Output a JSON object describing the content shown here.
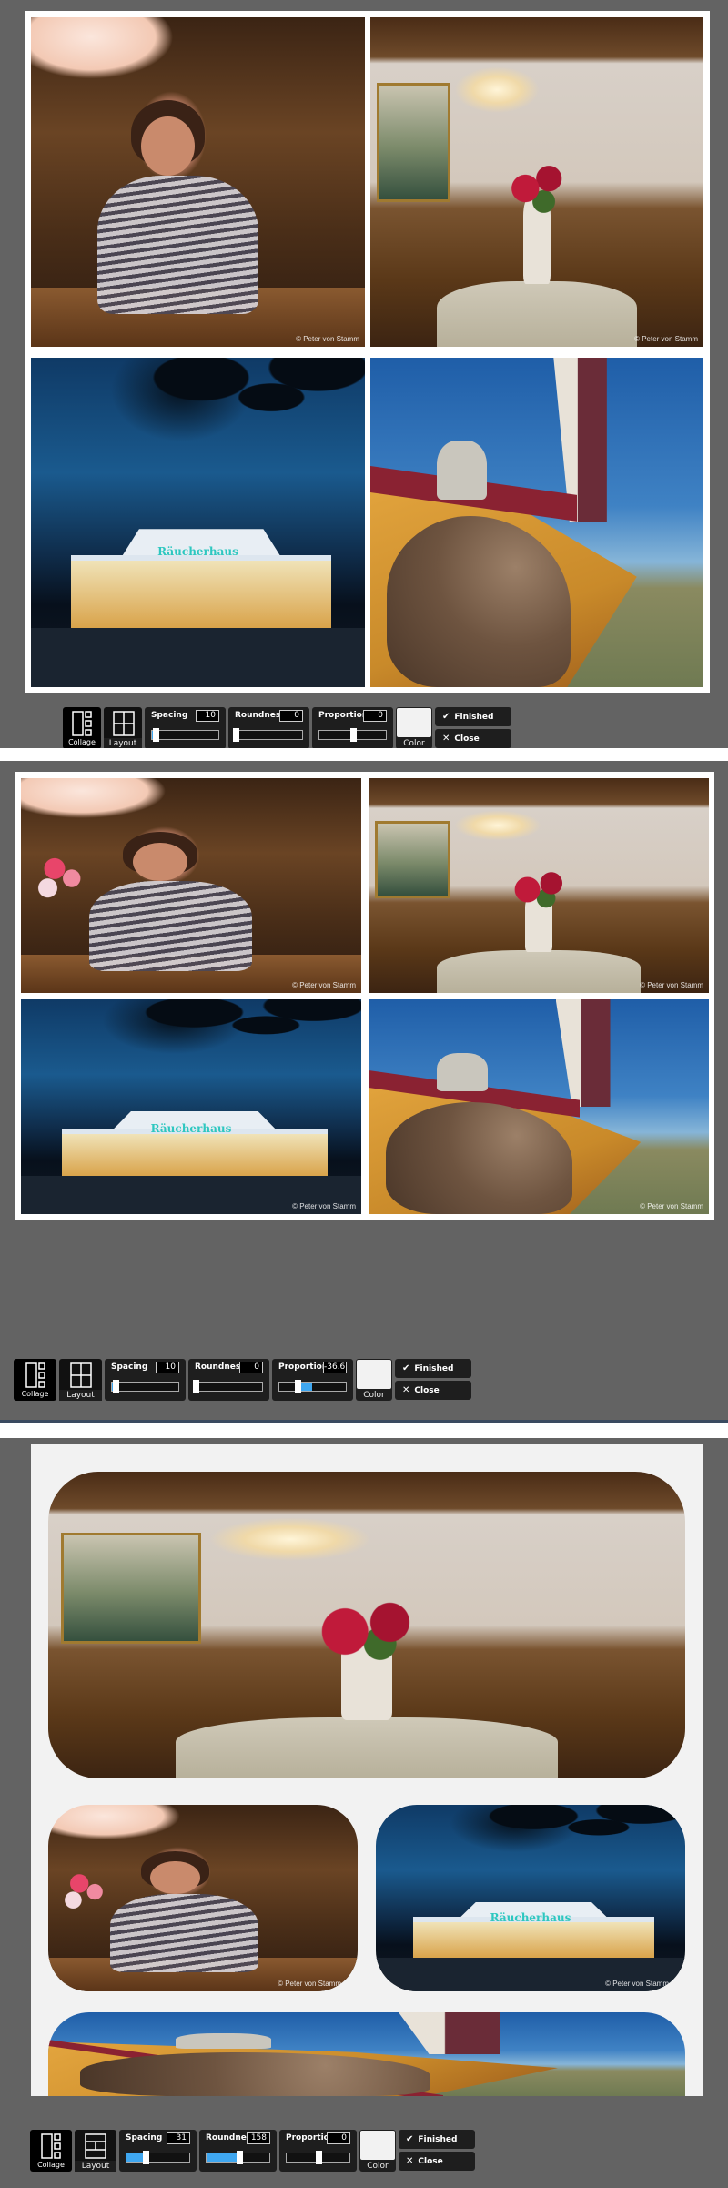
{
  "watermark": "© Peter von Stamm",
  "photos": {
    "woman": "Woman smiling at bar table",
    "room": "Restaurant interior with peonies",
    "night": "Räucherhaus restaurant at night",
    "boat": "Dog on sailing boat",
    "sign_text": "Räucherhaus"
  },
  "screens": [
    {
      "layout_icon": "grid-2x2-icon",
      "toolbar": {
        "collage_label": "Collage",
        "layout_label": "Layout",
        "spacing_label": "Spacing",
        "spacing_value": "10",
        "spacing_fraction": 0.05,
        "spacing_fill": 0.05,
        "roundness_label": "Roundness",
        "roundness_value": "0",
        "roundness_fraction": 0.0,
        "proportions_label": "Proportions",
        "proportions_value": "0",
        "proportions_fraction": 0.5,
        "color_label": "Color",
        "color_value": "#f2f2f2",
        "finished_label": "Finished",
        "close_label": "Close"
      }
    },
    {
      "layout_icon": "grid-2x2-icon",
      "toolbar": {
        "collage_label": "Collage",
        "layout_label": "Layout",
        "spacing_label": "Spacing",
        "spacing_value": "10",
        "spacing_fraction": 0.05,
        "roundness_label": "Roundness",
        "roundness_value": "0",
        "roundness_fraction": 0.0,
        "proportions_label": "Proportions",
        "proportions_value": "-36.6",
        "proportions_fraction": 0.27,
        "color_label": "Color",
        "color_value": "#f2f2f2",
        "finished_label": "Finished",
        "close_label": "Close"
      }
    },
    {
      "layout_icon": "grid-1-2-1-icon",
      "toolbar": {
        "collage_label": "Collage",
        "layout_label": "Layout",
        "spacing_label": "Spacing",
        "spacing_value": "31",
        "spacing_fraction": 0.31,
        "roundness_label": "Roundness",
        "roundness_value": "158",
        "roundness_fraction": 0.52,
        "proportions_label": "Proportions",
        "proportions_value": "0",
        "proportions_fraction": 0.5,
        "color_label": "Color",
        "color_value": "#f2f2f2",
        "finished_label": "Finished",
        "close_label": "Close"
      }
    }
  ]
}
